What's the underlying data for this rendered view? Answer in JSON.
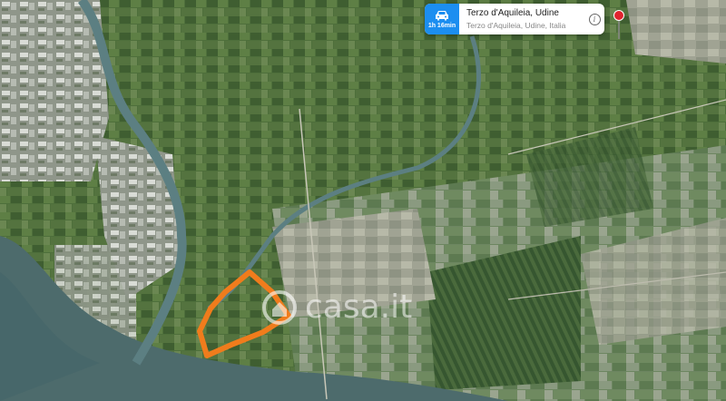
{
  "location_callout": {
    "travel_time": "1h 16min",
    "title": "Terzo d'Aquileia, Udine",
    "subtitle": "Terzo d'Aquileia, Udine, Italia",
    "info_icon": "info-icon",
    "travel_icon": "car-icon"
  },
  "map": {
    "view": "satellite",
    "marker_icon": "location-pin-icon",
    "marker_color": "#e0242e",
    "area_outline_color": "#f07c1c",
    "water_color": "#4d6b6c",
    "river_color": "#5c7f82"
  },
  "watermark": {
    "text": "casa.it",
    "logo_icon": "house-logo-icon"
  }
}
